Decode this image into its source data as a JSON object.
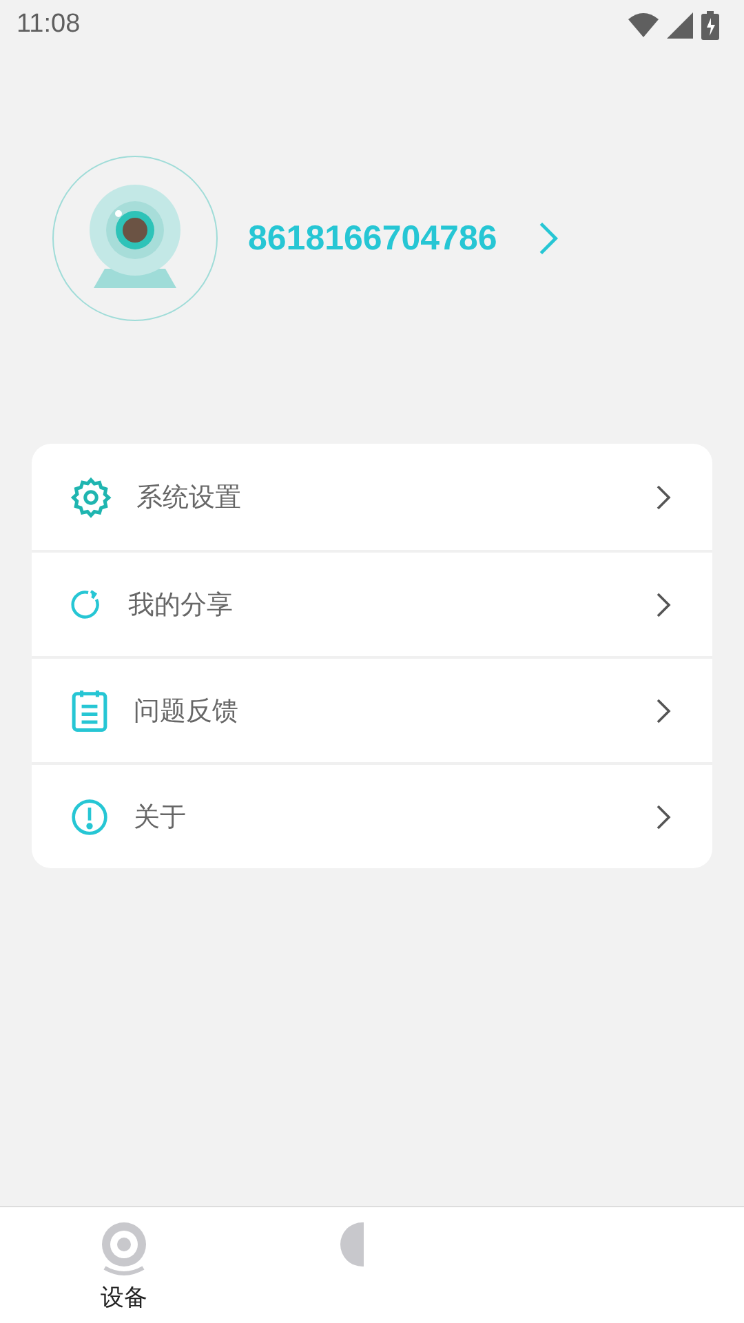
{
  "status_bar": {
    "time": "11:08"
  },
  "profile": {
    "account": "8618166704786"
  },
  "menu": [
    {
      "kind": "settings",
      "label": "系统设置"
    },
    {
      "kind": "share",
      "label": "我的分享"
    },
    {
      "kind": "feedback",
      "label": "问题反馈"
    },
    {
      "kind": "about",
      "label": "关于"
    }
  ],
  "bottom_nav": [
    {
      "kind": "device",
      "label": "设备"
    },
    {
      "kind": "album"
    }
  ]
}
